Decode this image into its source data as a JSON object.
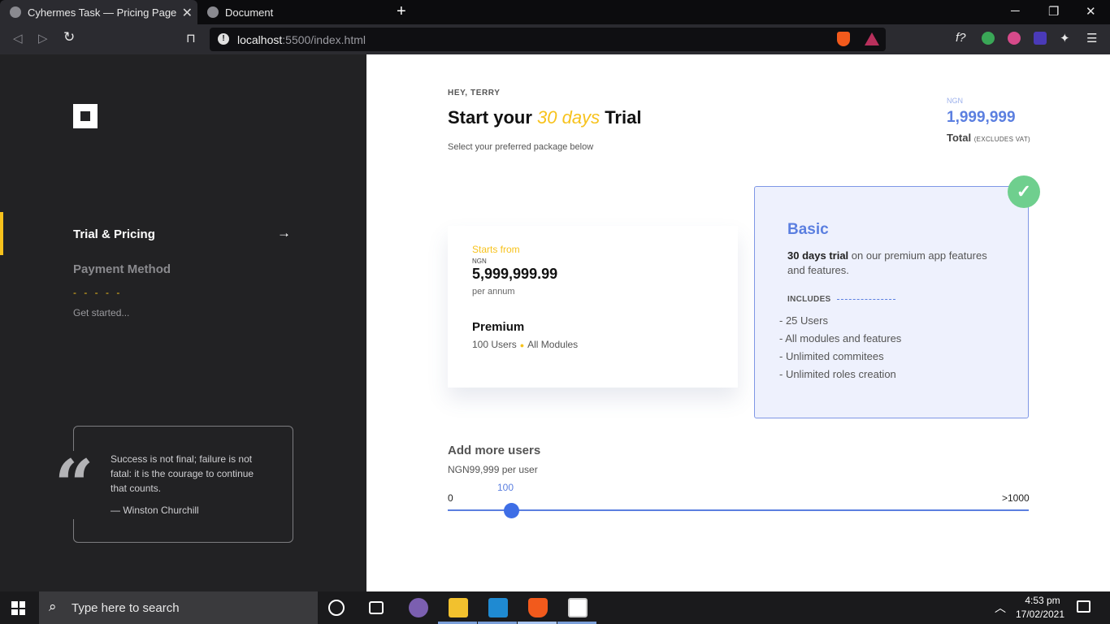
{
  "browser": {
    "tabs": [
      {
        "label": "Cyhermes Task — Pricing Page",
        "active": true
      },
      {
        "label": "Document",
        "active": false
      }
    ],
    "url_host": "localhost",
    "url_rest": ":5500/index.html"
  },
  "sidebar": {
    "steps": [
      {
        "label": "Trial & Pricing",
        "active": true
      },
      {
        "label": "Payment Method",
        "active": false
      }
    ],
    "dashes": "- - - - -",
    "get_started": "Get started...",
    "quote": {
      "text": "Success is not final; failure is not fatal: it is the courage to continue that counts.",
      "author": "— Winston Churchill"
    }
  },
  "main": {
    "greeting": "HEY, TERRY",
    "headline_pre": "Start your ",
    "headline_highlight": "30 days",
    "headline_post": " Trial",
    "subhead": "Select your preferred package below",
    "total": {
      "currency": "NGN",
      "amount": "1,999,999",
      "label": "Total",
      "note": "(EXCLUDES VAT)"
    },
    "premium": {
      "starts_from": "Starts from",
      "currency": "NGN",
      "price": "5,999,999.99",
      "period": "per annum",
      "name": "Premium",
      "users": "100 Users",
      "modules": "All Modules"
    },
    "basic": {
      "name": "Basic",
      "desc_bold": "30 days trial",
      "desc_rest": " on our premium app features and features.",
      "includes_label": "INCLUDES",
      "features": [
        "- 25 Users",
        "- All modules and features",
        "- Unlimited commitees",
        "- Unlimited roles creation"
      ]
    },
    "add_users": {
      "title": "Add more users",
      "price": "NGN99,999 per user",
      "min_label": "0",
      "max_label": ">1000",
      "value": "100"
    }
  },
  "taskbar": {
    "search_placeholder": "Type here to search",
    "time": "4:53 pm",
    "date": "17/02/2021"
  },
  "colors": {
    "accent_yellow": "#f7c21c",
    "accent_blue": "#5b7fe0",
    "sidebar_bg": "#222224",
    "check_green": "#6fcf8e"
  }
}
